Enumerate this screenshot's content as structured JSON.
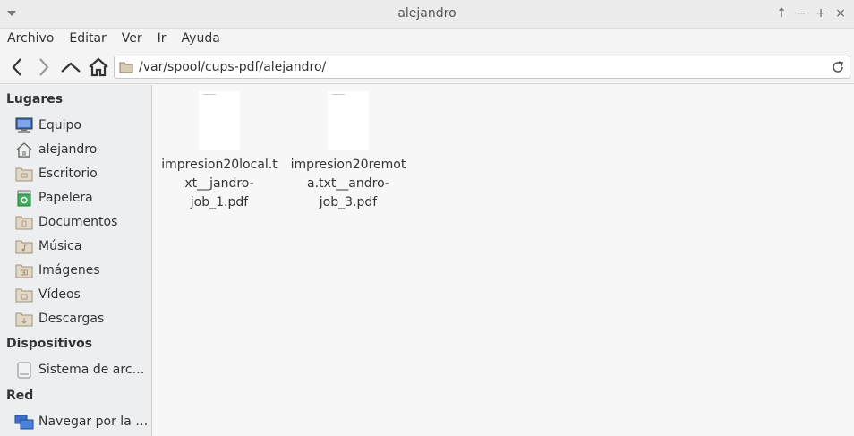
{
  "window": {
    "title": "alejandro",
    "controls": [
      "↑",
      "−",
      "+",
      "×"
    ]
  },
  "menubar": {
    "items": [
      "Archivo",
      "Editar",
      "Ver",
      "Ir",
      "Ayuda"
    ]
  },
  "toolbar": {
    "path": "/var/spool/cups-pdf/alejandro/"
  },
  "sidebar": {
    "places_header": "Lugares",
    "places": [
      {
        "label": "Equipo",
        "icon": "computer-icon"
      },
      {
        "label": "alejandro",
        "icon": "home-icon"
      },
      {
        "label": "Escritorio",
        "icon": "desktop-folder-icon"
      },
      {
        "label": "Papelera",
        "icon": "trash-icon"
      },
      {
        "label": "Documentos",
        "icon": "documents-folder-icon"
      },
      {
        "label": "Música",
        "icon": "music-folder-icon"
      },
      {
        "label": "Imágenes",
        "icon": "pictures-folder-icon"
      },
      {
        "label": "Vídeos",
        "icon": "videos-folder-icon"
      },
      {
        "label": "Descargas",
        "icon": "downloads-folder-icon"
      }
    ],
    "devices_header": "Dispositivos",
    "devices": [
      {
        "label": "Sistema de archivos",
        "icon": "drive-icon"
      }
    ],
    "network_header": "Red",
    "network": [
      {
        "label": "Navegar por la red",
        "icon": "network-icon"
      }
    ]
  },
  "files": [
    {
      "name": "impresion20local.txt__jandro-job_1.pdf",
      "lines": [
        "impresion20local.t",
        "xt__jandro-",
        "job_1.pdf"
      ]
    },
    {
      "name": "impresion20remota.txt__andro-job_3.pdf",
      "lines": [
        "impresion20remot",
        "a.txt__andro-",
        "job_3.pdf"
      ]
    }
  ],
  "colors": {
    "folder": "#c8b89a",
    "accent_blue": "#3b6fc9",
    "trash_green": "#3fae5a"
  }
}
